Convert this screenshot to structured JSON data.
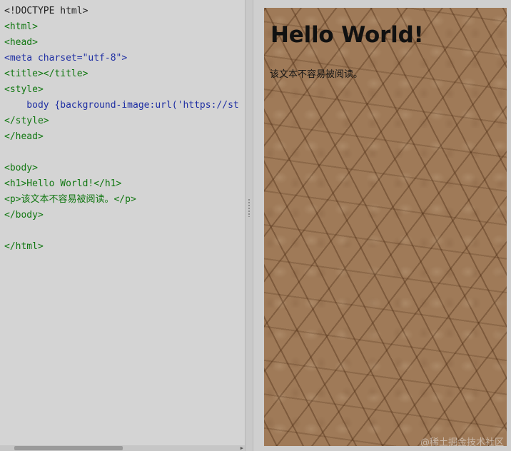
{
  "editor": {
    "lines": [
      "<!DOCTYPE html>",
      "<html>",
      "<head>",
      "<meta charset=\"utf-8\">",
      "<title></title>",
      "<style>",
      "    body {background-image:url('https://st",
      "</style>",
      "</head>",
      "",
      "<body>",
      "<h1>Hello World!</h1>",
      "<p>该文本不容易被阅读。</p>",
      "</body>",
      "",
      "</html>"
    ]
  },
  "preview": {
    "heading": "Hello World!",
    "paragraph": "该文本不容易被阅读。"
  },
  "watermark": "@稀土掘金技术社区",
  "colors": {
    "tag": "#117711",
    "attribute": "#1f2fa3",
    "string": "#aa1111",
    "editor_bg": "#d4d4d4",
    "preview_texture": "#9f7a58"
  }
}
